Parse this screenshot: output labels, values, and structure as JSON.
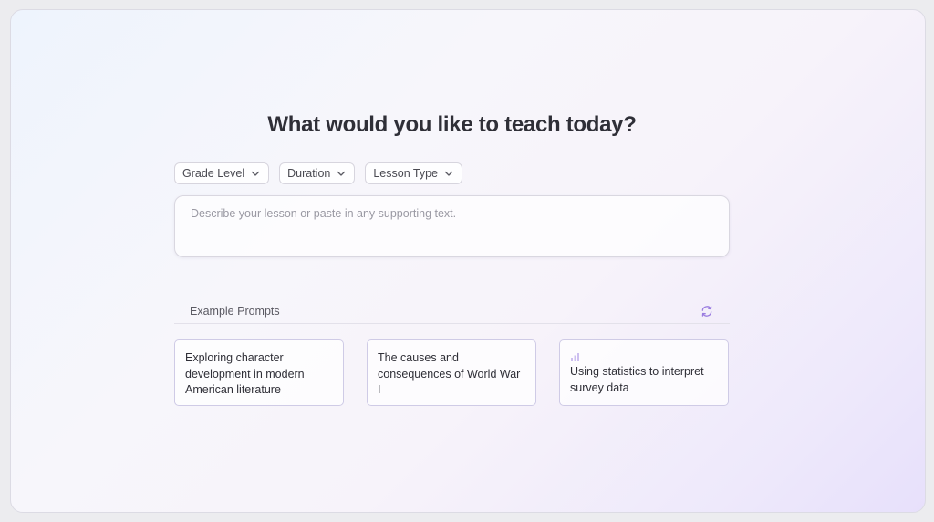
{
  "heading": "What would you like to teach today?",
  "filters": [
    {
      "label": "Grade Level",
      "icon": "chevron-down-icon"
    },
    {
      "label": "Duration",
      "icon": "chevron-down-icon"
    },
    {
      "label": "Lesson Type",
      "icon": "chevron-down-icon"
    }
  ],
  "lesson_input": {
    "value": "",
    "placeholder": "Describe your lesson or paste in any supporting text."
  },
  "examples": {
    "label": "Example Prompts",
    "refresh_icon": "refresh-icon",
    "accent_color": "#9b7de0",
    "prompts": [
      {
        "text": "Exploring character development in modern American literature"
      },
      {
        "text": "The causes and consequences of World War I"
      },
      {
        "text": "Using statistics to interpret survey data",
        "icon": "bar-chart-icon"
      }
    ]
  },
  "colors": {
    "card_border": "#cfcbe6",
    "heading": "#2f2f37"
  }
}
